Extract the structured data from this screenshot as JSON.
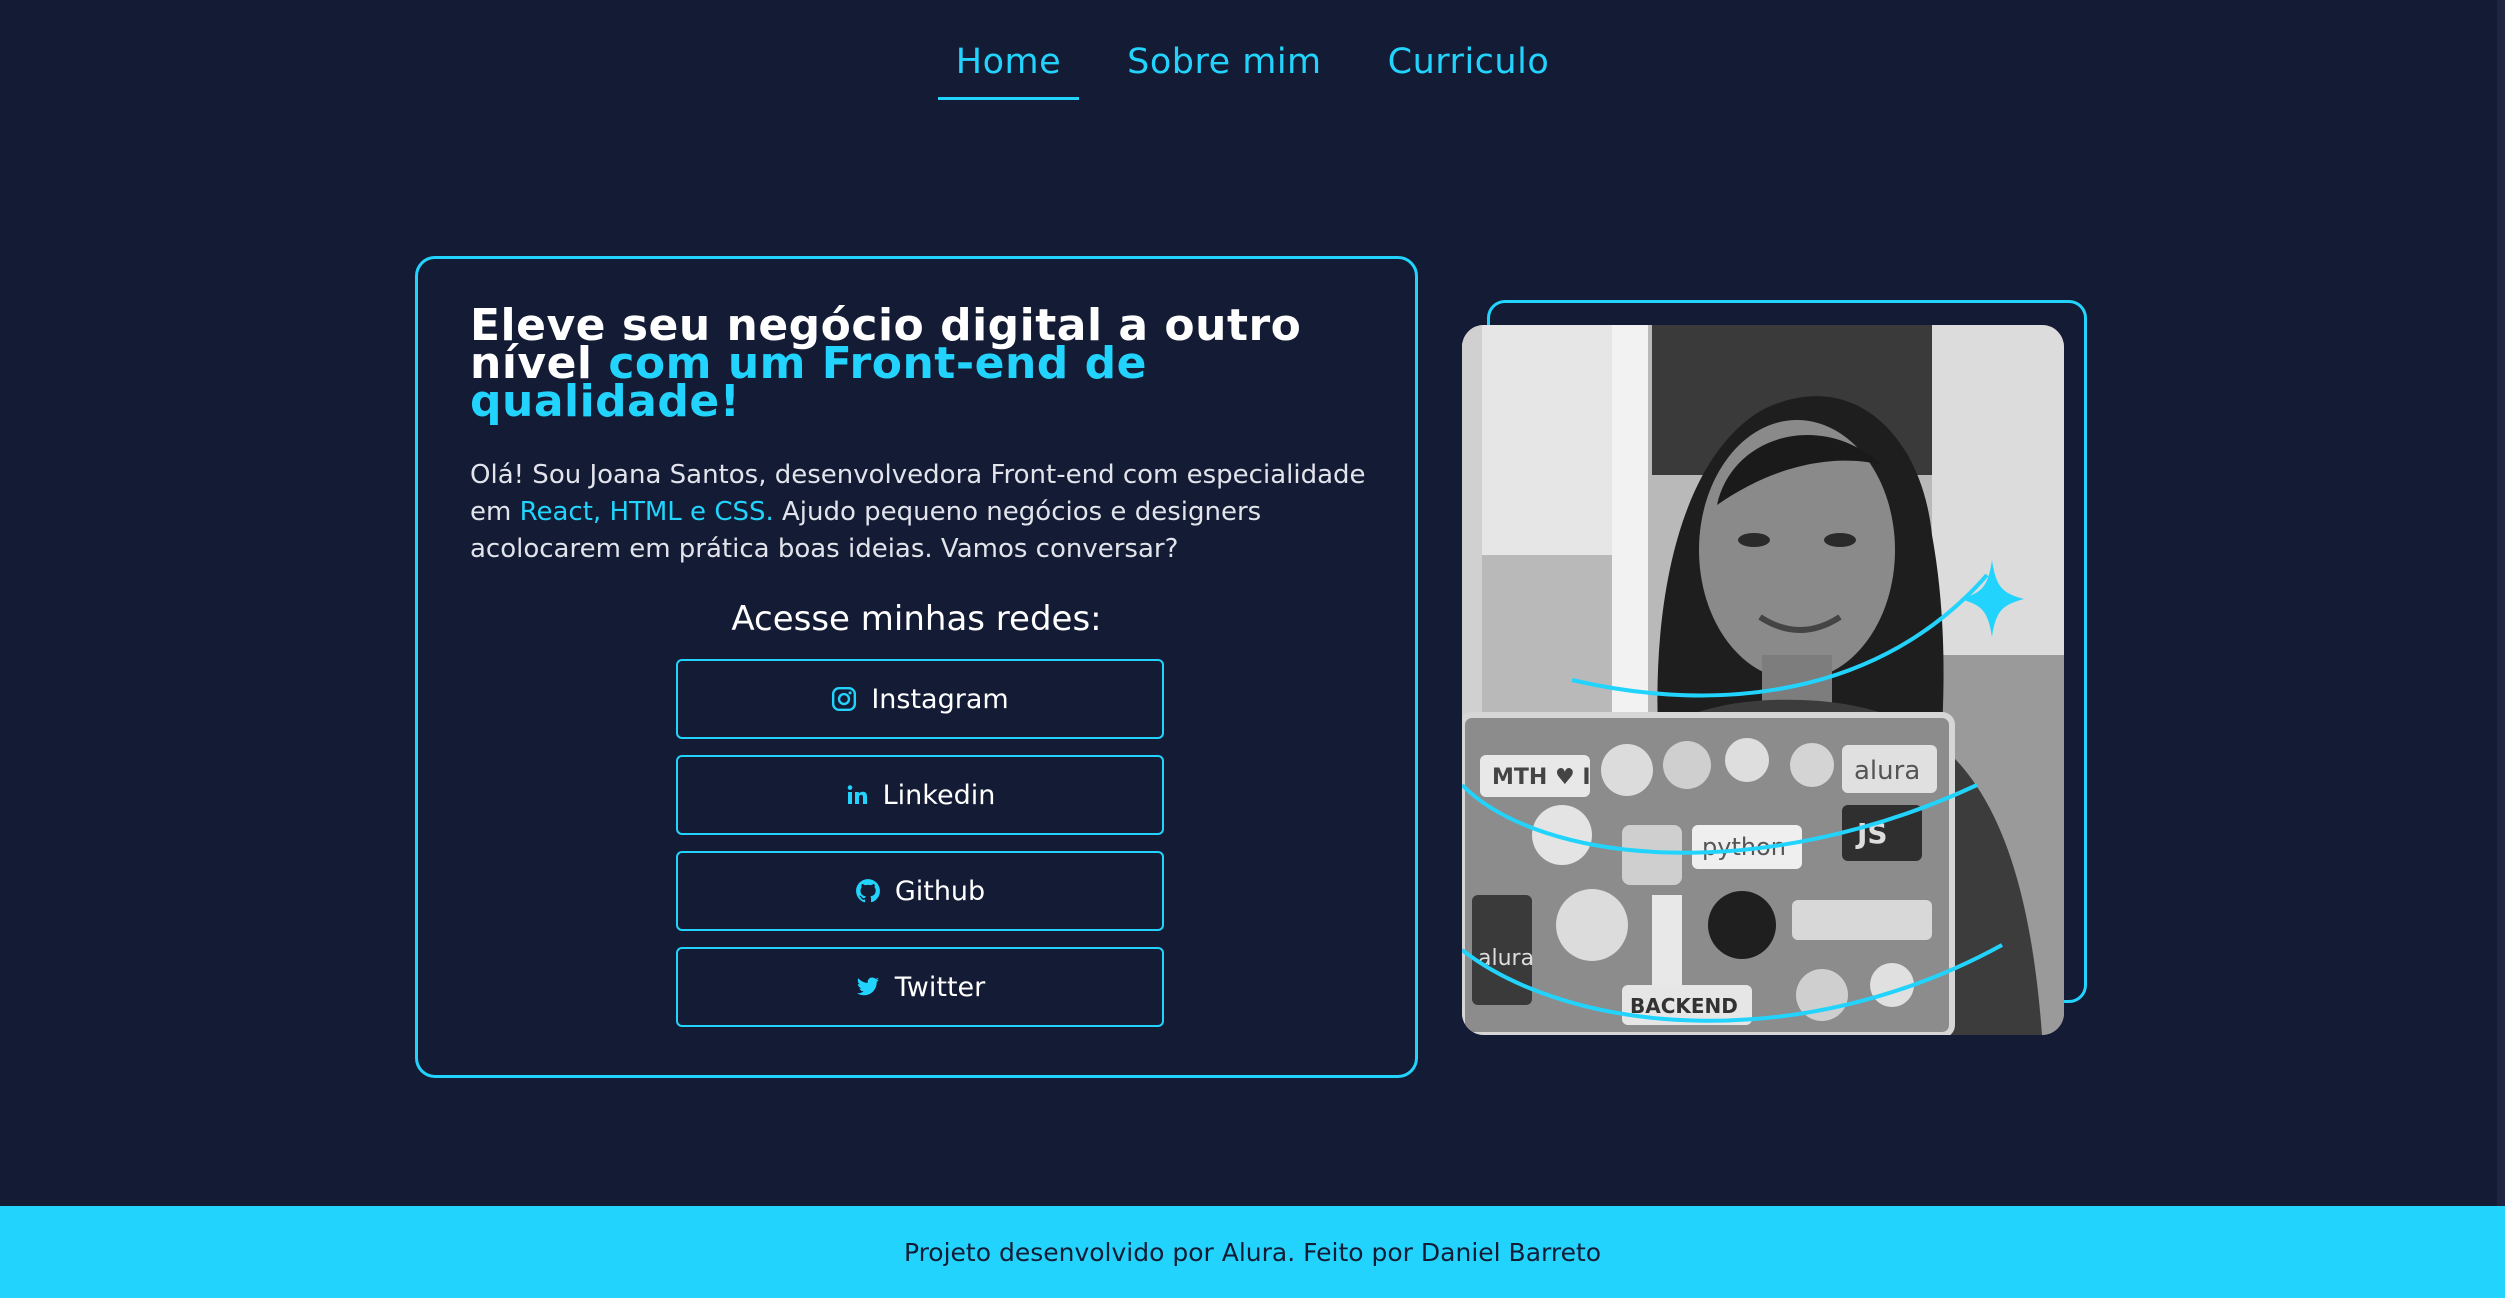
{
  "nav": {
    "items": [
      {
        "label": "Home",
        "active": true
      },
      {
        "label": "Sobre mim",
        "active": false
      },
      {
        "label": "Curriculo",
        "active": false
      }
    ]
  },
  "hero": {
    "headline_part1": "Eleve seu negócio digital a outro nível ",
    "headline_accent": "com um Front-end de qualidade!",
    "intro_part1": "Olá! Sou Joana Santos, desenvolvedora Front-end com especialidade em ",
    "intro_accent": "React, HTML e CSS.",
    "intro_part2": " Ajudo pequeno negócios e designers acolocarem em prática boas ideias. Vamos conversar?",
    "social_title": "Acesse minhas redes:",
    "social": [
      {
        "label": "Instagram",
        "icon": "instagram-icon"
      },
      {
        "label": "Linkedin",
        "icon": "linkedin-icon"
      },
      {
        "label": "Github",
        "icon": "github-icon"
      },
      {
        "label": "Twitter",
        "icon": "twitter-icon"
      }
    ]
  },
  "photo": {
    "sticker_texts": [
      "MTH ♥ I",
      "alura",
      "JS",
      "python",
      "alura",
      "BACKEND"
    ]
  },
  "footer": {
    "text": "Projeto desenvolvido por Alura. Feito por Daniel Barreto"
  },
  "colors": {
    "background": "#141b34",
    "accent": "#22d4fd",
    "text": "#ffffff"
  }
}
